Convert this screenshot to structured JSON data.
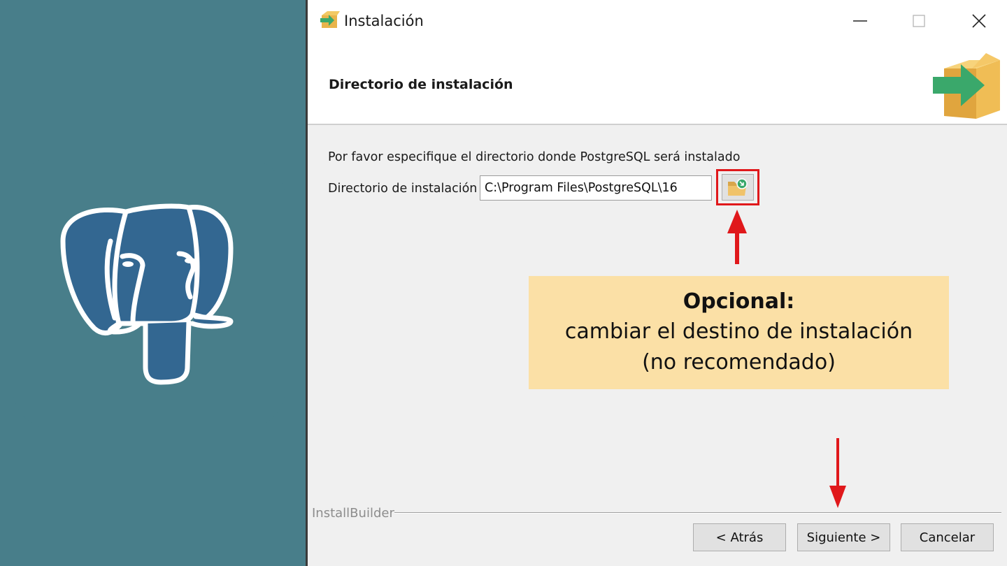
{
  "window": {
    "title": "Instalación",
    "minimize_icon": "minimize-icon",
    "maximize_icon": "maximize-icon",
    "close_icon": "close-icon"
  },
  "header": {
    "title": "Directorio de instalación",
    "icon": "install-box-arrow-icon"
  },
  "content": {
    "description": "Por favor especifique el directorio donde PostgreSQL será instalado",
    "dir_label": "Directorio de instalación",
    "dir_value": "C:\\Program Files\\PostgreSQL\\16",
    "browse_icon": "folder-browse-icon"
  },
  "callout": {
    "title": "Opcional:",
    "line1": "cambiar el destino de instalación",
    "line2": "(no recomendado)",
    "background": "#fbe0a6"
  },
  "footer": {
    "brand": "InstallBuilder",
    "back_label": "< Atrás",
    "next_label": "Siguiente >",
    "cancel_label": "Cancelar"
  },
  "colors": {
    "side_background": "#487e8a",
    "logo_blue": "#336791",
    "highlight_red": "#e0181b"
  },
  "logo": "postgresql-elephant-logo"
}
